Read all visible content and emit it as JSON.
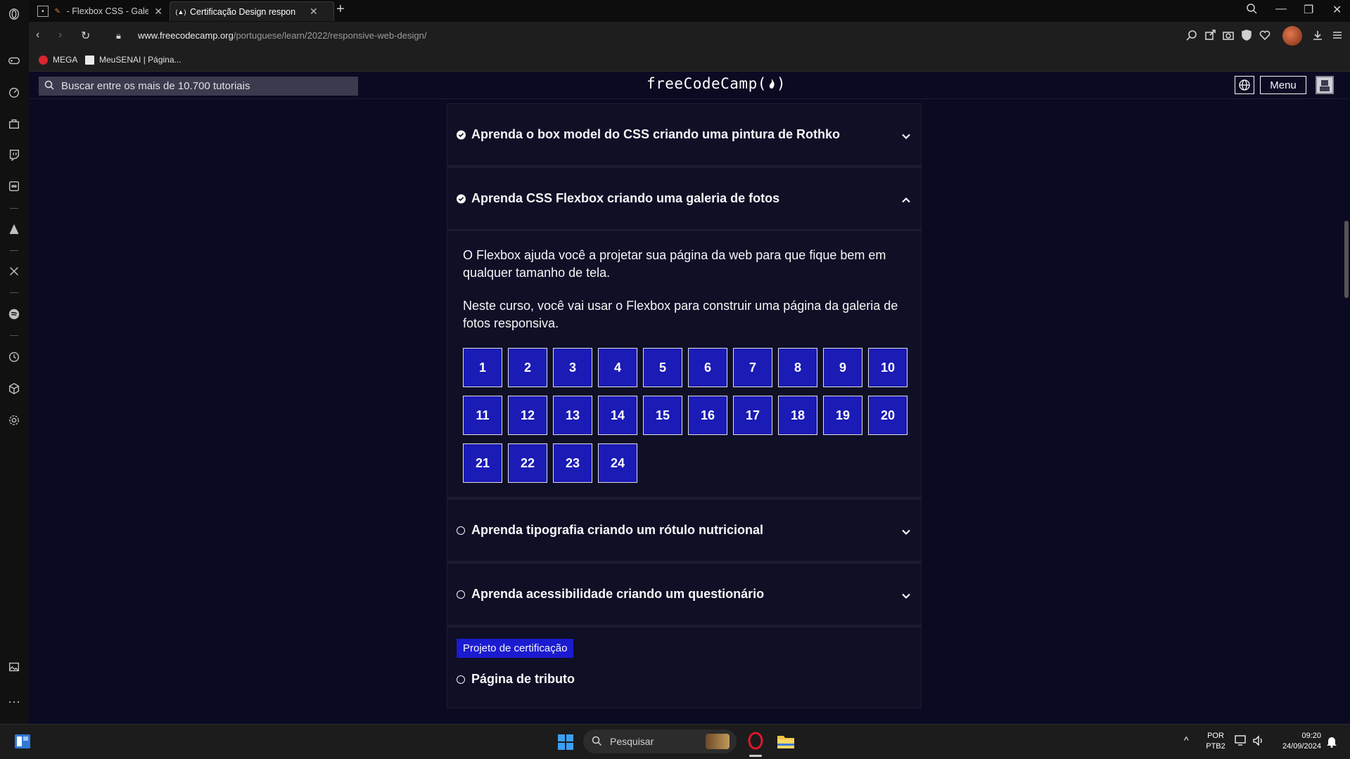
{
  "browser": {
    "tabs": [
      {
        "label": "- Flexbox CSS - Galeria",
        "active": false
      },
      {
        "label": "Certificação Design respon",
        "active": true
      }
    ],
    "url_host": "www.freecodecamp.org",
    "url_path": "/portuguese/learn/2022/responsive-web-design/",
    "bookmarks": [
      {
        "label": "MEGA"
      },
      {
        "label": "MeuSENAI | Página..."
      }
    ]
  },
  "fcc": {
    "search_placeholder": "Buscar entre os mais de 10.700 tutoriais",
    "logo": "freeCodeCamp(🔥)",
    "logo_text": "freeCodeCamp",
    "menu_label": "Menu"
  },
  "blocks": [
    {
      "title": "Aprenda o box model do CSS criando uma pintura de Rothko",
      "completed": true,
      "expanded": false
    },
    {
      "title": "Aprenda CSS Flexbox criando uma galeria de fotos",
      "completed": true,
      "expanded": true
    },
    {
      "title": "Aprenda tipografia criando um rótulo nutricional",
      "completed": false,
      "expanded": false
    },
    {
      "title": "Aprenda acessibilidade criando um questionário",
      "completed": false,
      "expanded": false
    }
  ],
  "flexbox_block": {
    "paragraph1": "O Flexbox ajuda você a projetar sua página da web para que fique bem em qualquer tamanho de tela.",
    "paragraph2": "Neste curso, você vai usar o Flexbox para construir uma página da galeria de fotos responsiva.",
    "steps": [
      "1",
      "2",
      "3",
      "4",
      "5",
      "6",
      "7",
      "8",
      "9",
      "10",
      "11",
      "12",
      "13",
      "14",
      "15",
      "16",
      "17",
      "18",
      "19",
      "20",
      "21",
      "22",
      "23",
      "24"
    ]
  },
  "certification": {
    "badge": "Projeto de certificação",
    "project": "Página de tributo"
  },
  "taskbar": {
    "search": "Pesquisar",
    "lang_top": "POR",
    "lang_bottom": "PTB2",
    "time": "09:20",
    "date": "24/09/2024"
  },
  "colors": {
    "page_bg": "#0a0a23",
    "step_bg": "#1b1bb5",
    "badge_bg": "#1b1bd0"
  }
}
